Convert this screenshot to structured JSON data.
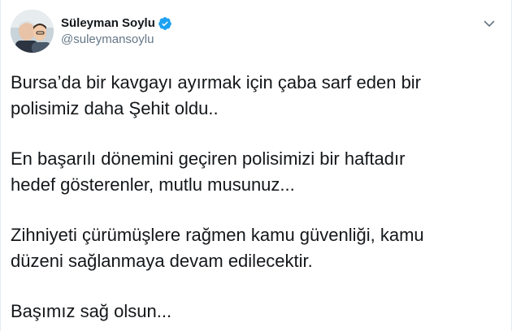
{
  "author": {
    "display_name": "Süleyman Soylu",
    "handle": "@suleymansoylu"
  },
  "icons": {
    "verified": "verified-badge-icon",
    "menu": "chevron-down-icon"
  },
  "colors": {
    "verified": "#1da1f2",
    "text": "#14171a",
    "muted": "#657786"
  },
  "tweet": {
    "paragraphs": [
      {
        "line1": "Bursa’da bir kavgayı ayırmak için çaba sarf eden bir",
        "line2": "polisimiz daha Şehit oldu.."
      },
      {
        "line1": "En başarılı dönemini geçiren polisimizi bir haftadır",
        "line2": "hedef gösterenler, mutlu musunuz..."
      },
      {
        "line1": "Zihniyeti çürümüşlere rağmen kamu güvenliği, kamu",
        "line2": "düzeni sağlanmaya devam edilecektir."
      },
      {
        "line1": "Başımız sağ olsun...",
        "line2": ""
      }
    ]
  }
}
